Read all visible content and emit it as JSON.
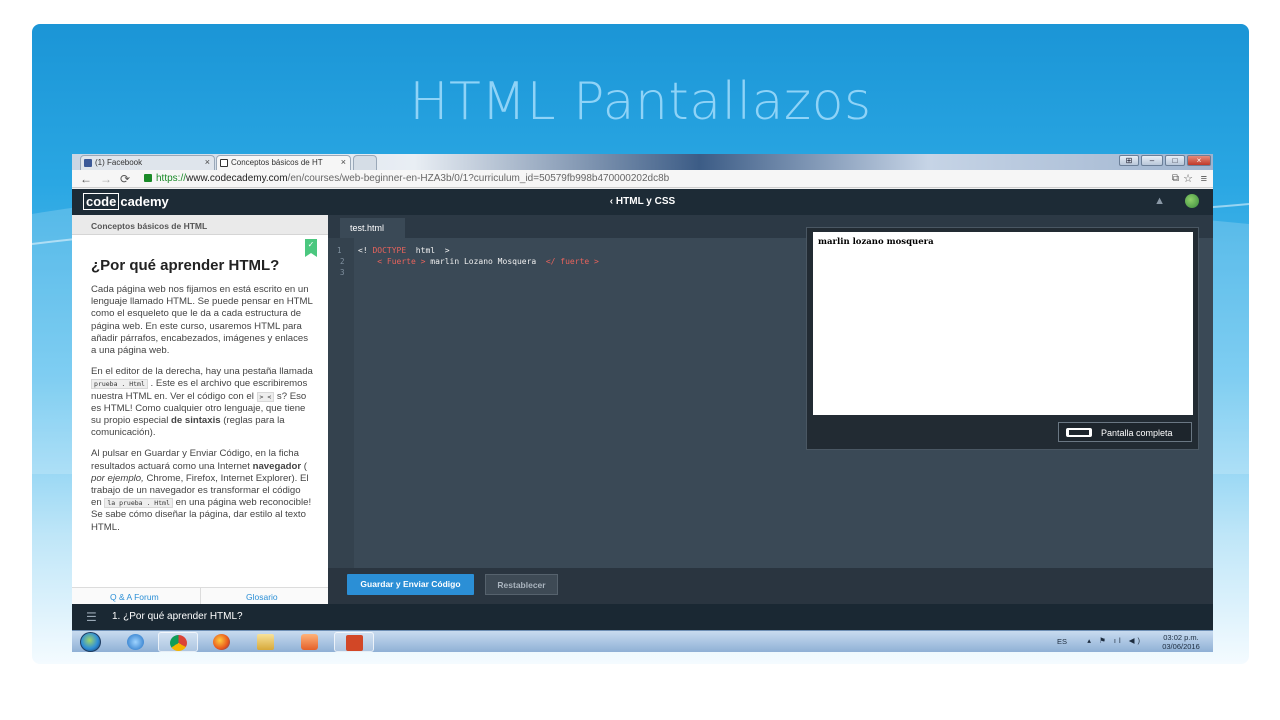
{
  "slide": {
    "title": "HTML Pantallazos"
  },
  "browser": {
    "tabs": [
      {
        "label": "(1) Facebook",
        "icon": "facebook-icon",
        "active": false
      },
      {
        "label": "Conceptos básicos de HT",
        "icon": "codecademy-icon",
        "active": true
      }
    ],
    "url_scheme": "https://",
    "url_host": "www.codecademy.com",
    "url_path": "/en/courses/web-beginner-en-HZA3b/0/1?curriculum_id=50579fb998b470000202dc8b"
  },
  "header": {
    "logo_box": "code",
    "logo_rest": "cademy",
    "course": "‹ HTML y CSS"
  },
  "lesson": {
    "section": "Conceptos básicos de HTML",
    "title": "¿Por qué aprender HTML?",
    "p1": "Cada página web nos fijamos en está escrito en un lenguaje llamado HTML. Se puede pensar en HTML como el esqueleto que le da a cada estructura de página web. En este curso, usaremos HTML para añadir párrafos, encabezados, imágenes y enlaces a una página web.",
    "p2_a": "En el editor de la derecha, hay una pestaña llamada ",
    "p2_code1": "prueba . Html",
    "p2_b": " . Este es el archivo que escribiremos nuestra HTML en. Ver el código con el ",
    "p2_code2": "> <",
    "p2_c": " s? Eso es HTML! Como cualquier otro lenguaje, que tiene su propio especial ",
    "p2_bold": "de sintaxis",
    "p2_d": " (reglas para la comunicación).",
    "p3_a": "Al pulsar en Guardar y Enviar Código, en la ficha resultados actuará como una Internet ",
    "p3_bold": "navegador",
    "p3_b": " ( ",
    "p3_em": "por ejemplo,",
    "p3_c": " Chrome, Firefox, Internet Explorer). El trabajo de un navegador es transformar el código en ",
    "p3_code1": "la prueba . Html",
    "p3_d": " en una página web reconocible! Se sabe cómo diseñar la página, dar estilo al texto HTML.",
    "footer_left": "Q & A Forum",
    "footer_right": "Glosario"
  },
  "editor": {
    "file_tab": "test.html",
    "line_numbers": [
      "1",
      "2",
      "3"
    ],
    "line1_a": "<! ",
    "line1_b": "DOCTYPE",
    "line1_c": "  html  >",
    "line2_a": "    < Fuerte > ",
    "line2_b": "marlin Lozano Mosquera",
    "line2_c": "  </ fuerte >"
  },
  "preview": {
    "output_text": "marlin lozano mosquera",
    "fullscreen_label": "Pantalla completa"
  },
  "actions": {
    "save_label": "Guardar y Enviar Código",
    "reset_label": "Restablecer"
  },
  "bottom_nav": {
    "title": "1. ¿Por qué aprender HTML?"
  },
  "taskbar": {
    "language": "ES",
    "time": "03:02 p.m.",
    "date": "03/06/2016"
  }
}
